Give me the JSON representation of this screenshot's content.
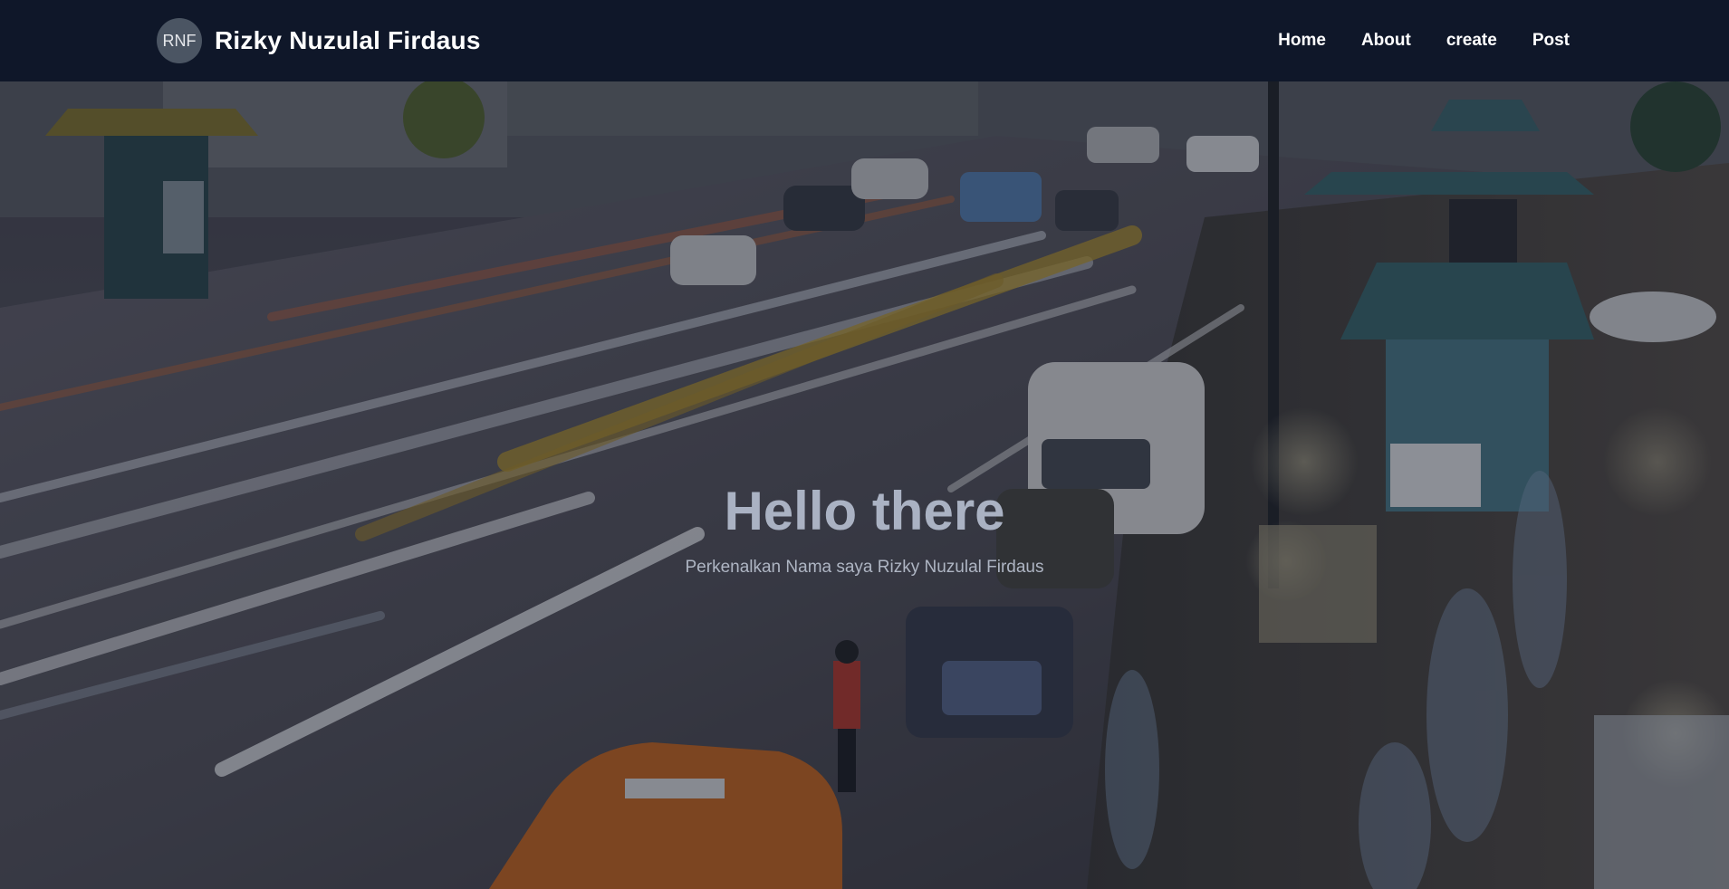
{
  "brand": {
    "avatar_initials": "RNF",
    "name": "Rizky Nuzulal Firdaus"
  },
  "nav": {
    "items": [
      {
        "label": "Home"
      },
      {
        "label": "About"
      },
      {
        "label": "create"
      },
      {
        "label": "Post"
      }
    ]
  },
  "hero": {
    "title": "Hello there",
    "subtitle": "Perkenalkan Nama saya Rizky Nuzulal Firdaus",
    "background": "night-city-street-traffic-photo"
  },
  "colors": {
    "navbar": "#0f1729",
    "overlay": "#111827",
    "title": "#aab2c3",
    "text": "#ffffff"
  }
}
